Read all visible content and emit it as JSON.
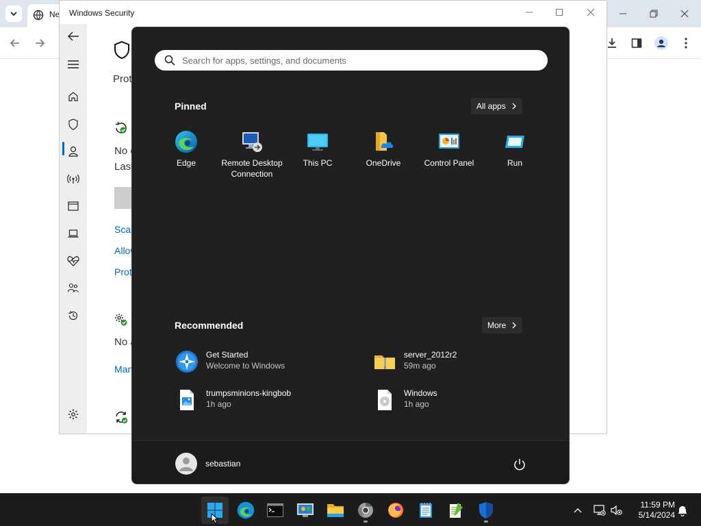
{
  "browser": {
    "tab_title": "Ne",
    "colors": {
      "tabstrip": "#dfe5ed"
    }
  },
  "winsec": {
    "title": "Windows Security",
    "page_heading_partial": "Prot",
    "no_threats_partial": "No c",
    "last_scan_partial": "Last",
    "link_scan": "Scan",
    "link_allowed": "Allow",
    "link_protection": "Prot",
    "no_actions_partial": "No a",
    "link_manage": "Man",
    "accent": "#0067c0"
  },
  "start_menu": {
    "search_placeholder": "Search for apps, settings, and documents",
    "pinned_heading": "Pinned",
    "all_apps_label": "All apps",
    "pinned": [
      {
        "label": "Edge",
        "icon": "edge-icon"
      },
      {
        "label": "Remote Desktop Connection",
        "icon": "remote-desktop-icon"
      },
      {
        "label": "This PC",
        "icon": "this-pc-icon"
      },
      {
        "label": "OneDrive",
        "icon": "onedrive-icon"
      },
      {
        "label": "Control Panel",
        "icon": "control-panel-icon"
      },
      {
        "label": "Run",
        "icon": "run-icon"
      }
    ],
    "recommended_heading": "Recommended",
    "more_label": "More",
    "recommended": [
      {
        "name": "Get Started",
        "detail": "Welcome to Windows",
        "icon": "get-started-icon"
      },
      {
        "name": "server_2012r2",
        "detail": "59m ago",
        "icon": "zip-folder-icon"
      },
      {
        "name": "trumpsminions-kingbob",
        "detail": "1h ago",
        "icon": "image-file-icon"
      },
      {
        "name": "Windows",
        "detail": "1h ago",
        "icon": "disc-image-icon"
      }
    ],
    "user_name": "sebastian",
    "colors": {
      "background": "#202020",
      "footer": "#1b1b1b"
    }
  },
  "taskbar": {
    "apps": [
      {
        "name": "start-button",
        "icon": "windows-logo-icon",
        "active": true
      },
      {
        "name": "edge",
        "icon": "edge-icon",
        "active": false
      },
      {
        "name": "terminal",
        "icon": "terminal-icon",
        "active": false
      },
      {
        "name": "remote-desktop",
        "icon": "remote-desktop-icon",
        "active": false
      },
      {
        "name": "file-explorer",
        "icon": "folder-icon",
        "active": false
      },
      {
        "name": "chrome",
        "icon": "chrome-icon",
        "active": false
      },
      {
        "name": "firefox",
        "icon": "firefox-icon",
        "active": false
      },
      {
        "name": "notepad",
        "icon": "notepad-icon",
        "active": false
      },
      {
        "name": "notepad-plus-plus",
        "icon": "notepad-plus-plus-icon",
        "active": false
      },
      {
        "name": "windows-security",
        "icon": "shield-icon",
        "active": false
      }
    ],
    "time": "11:59 PM",
    "date": "5/14/2024",
    "colors": {
      "background": "#1c1c1c"
    }
  }
}
